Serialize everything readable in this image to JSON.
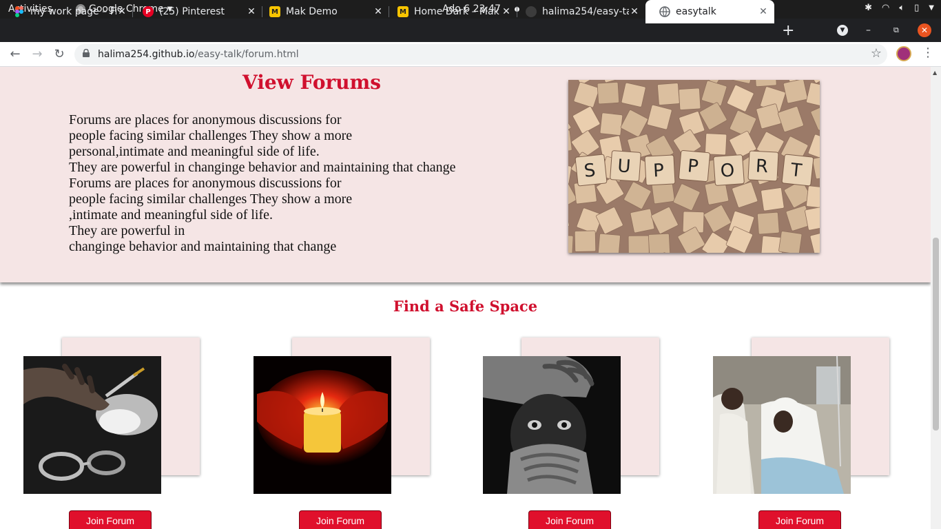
{
  "system": {
    "activities": "Activities",
    "app_name": "Google Chrome",
    "clock": "Ado 6  23:47"
  },
  "browser": {
    "tabs": [
      {
        "title": "my work page – Fi",
        "favicon": "figma-icon"
      },
      {
        "title": "(25) Pinterest",
        "favicon": "pinterest-icon"
      },
      {
        "title": "Mak Demo",
        "favicon": "m-logo-icon"
      },
      {
        "title": "Home Dark – Mak",
        "favicon": "m-logo-icon"
      },
      {
        "title": "halima254/easy-ta",
        "favicon": "github-icon"
      },
      {
        "title": "easytalk",
        "favicon": "globe-icon",
        "active": true
      }
    ],
    "url_host": "halima254.github.io",
    "url_path": "/easy-talk/forum.html"
  },
  "forum": {
    "title": "View Forums",
    "lines": [
      "Forums are places for anonymous discussions for",
      "people facing similar challenges They show a more",
      "personal,intimate and meaningful side of life.",
      "They are powerful in changinge behavior and maintaining that change",
      "Forums are places for anonymous discussions for",
      "people facing similar challenges They show a more",
      ",intimate and meaningful side of life.",
      "They are powerful in",
      "changinge behavior and maintaining that change"
    ],
    "image_text": "SUPPORT",
    "tile_letters": [
      "S",
      "U",
      "P",
      "P",
      "O",
      "R",
      "T"
    ]
  },
  "safe_space": {
    "title": "Find a Safe Space",
    "cards": [
      {
        "image": "drugs-handcuffs-photo",
        "button": "Join Forum"
      },
      {
        "image": "candle-hands-photo",
        "button": "Join Forum"
      },
      {
        "image": "covered-mouth-photo",
        "button": "Join Forum"
      },
      {
        "image": "hospital-bed-photo",
        "button": "Join Forum"
      }
    ]
  },
  "colors": {
    "accent_red": "#d0102e",
    "section_bg": "#f5e5e5",
    "button_red": "#e0102c"
  }
}
